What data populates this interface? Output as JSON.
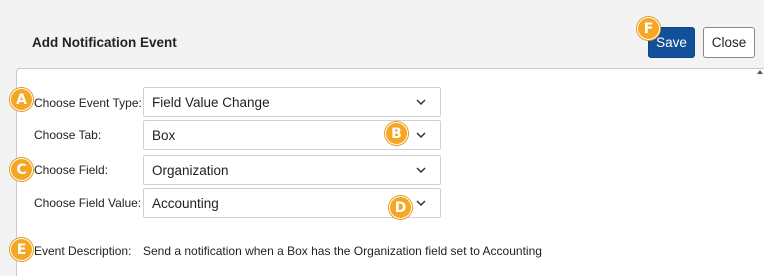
{
  "dialog": {
    "title": "Add Notification Event",
    "save_label": "Save",
    "close_label": "Close"
  },
  "form": {
    "event_type": {
      "label": "Choose Event Type:",
      "value": "Field Value Change"
    },
    "tab": {
      "label": "Choose Tab:",
      "value": "Box"
    },
    "field": {
      "label": "Choose Field:",
      "value": "Organization"
    },
    "field_value": {
      "label": "Choose Field Value:",
      "value": "Accounting"
    },
    "description": {
      "label": "Event Description:",
      "text": "Send a notification when a Box has the Organization field set to Accounting"
    }
  },
  "markers": [
    "A",
    "B",
    "C",
    "D",
    "E",
    "F"
  ],
  "colors": {
    "marker": "#f5a623",
    "save_button": "#12519a",
    "background": "#f3f3f3"
  },
  "icons": {
    "select_arrow": "chevron-down-icon",
    "scroll": "scroll-up-arrow-icon"
  }
}
